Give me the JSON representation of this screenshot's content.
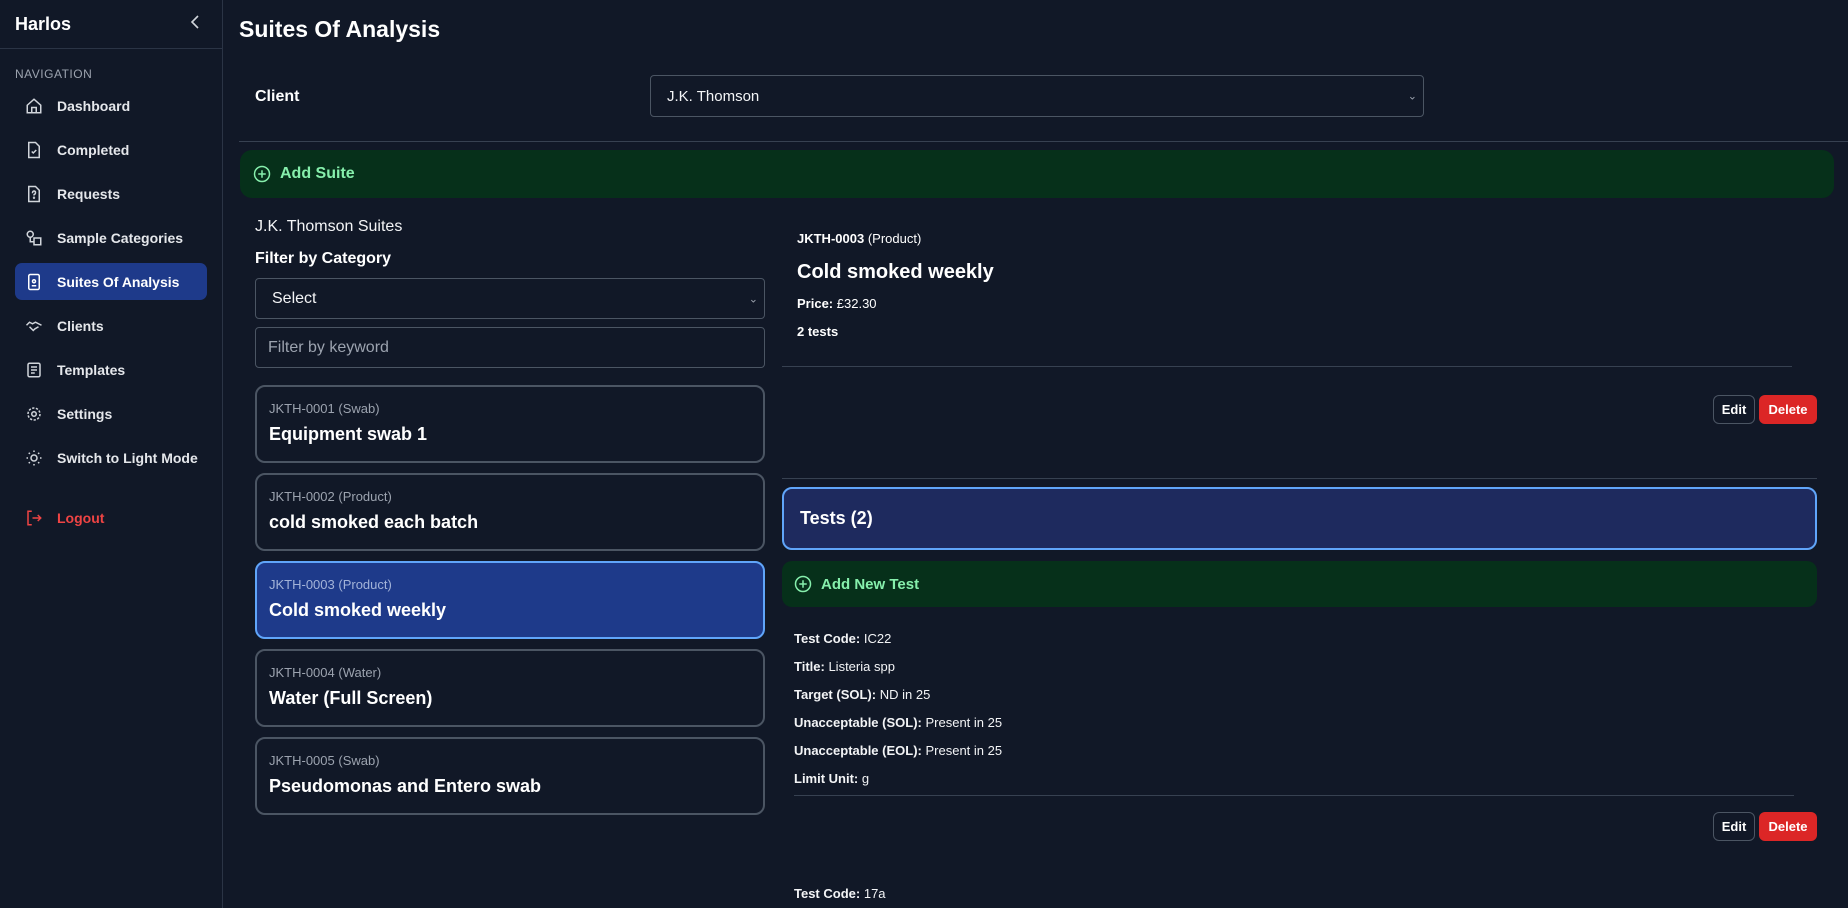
{
  "sidebar": {
    "brand": "Harlos",
    "heading": "NAVIGATION",
    "items": [
      {
        "label": "Dashboard",
        "icon": "home-icon"
      },
      {
        "label": "Completed",
        "icon": "file-check-icon"
      },
      {
        "label": "Requests",
        "icon": "file-question-icon"
      },
      {
        "label": "Sample Categories",
        "icon": "shapes-icon"
      },
      {
        "label": "Suites Of Analysis",
        "icon": "badge-icon"
      },
      {
        "label": "Clients",
        "icon": "handshake-icon"
      },
      {
        "label": "Templates",
        "icon": "list-doc-icon"
      },
      {
        "label": "Settings",
        "icon": "gear-icon"
      },
      {
        "label": "Switch to Light Mode",
        "icon": "sun-icon"
      }
    ],
    "logout": "Logout"
  },
  "page": {
    "title": "Suites Of Analysis",
    "client_label": "Client",
    "client_value": "J.K. Thomson",
    "add_suite": "Add Suite"
  },
  "left": {
    "heading": "J.K. Thomson Suites",
    "filter_label": "Filter by Category",
    "category_value": "Select",
    "keyword_placeholder": "Filter by keyword",
    "suites": [
      {
        "code": "JKTH-0001 (Swab)",
        "name": "Equipment swab 1"
      },
      {
        "code": "JKTH-0002 (Product)",
        "name": "cold smoked each batch"
      },
      {
        "code": "JKTH-0003 (Product)",
        "name": "Cold smoked weekly"
      },
      {
        "code": "JKTH-0004 (Water)",
        "name": "Water (Full Screen)"
      },
      {
        "code": "JKTH-0005 (Swab)",
        "name": "Pseudomonas and Entero swab"
      }
    ]
  },
  "detail": {
    "code": "JKTH-0003",
    "category": "(Product)",
    "title": "Cold smoked weekly",
    "price_label": "Price:",
    "price": "£32.30",
    "test_count": "2 tests",
    "edit": "Edit",
    "delete": "Delete",
    "tests_header": "Tests (2)",
    "add_test": "Add New Test",
    "tests": [
      {
        "code_label": "Test Code:",
        "code": "IC22",
        "title_label": "Title:",
        "title": "Listeria spp",
        "target_label": "Target (SOL):",
        "target": "ND in 25",
        "unacc_sol_label": "Unacceptable (SOL):",
        "unacc_sol": "Present in 25",
        "unacc_eol_label": "Unacceptable (EOL):",
        "unacc_eol": "Present in 25",
        "unit_label": "Limit Unit:",
        "unit": "g"
      },
      {
        "code_label": "Test Code:",
        "code": "17a"
      }
    ]
  }
}
